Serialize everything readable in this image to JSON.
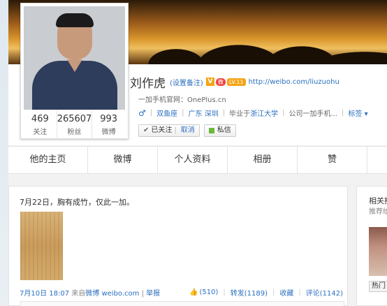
{
  "profile": {
    "name": "刘作虎",
    "remark_link": "(设置备注)",
    "badge_v": "V",
    "badge_club": "微",
    "badge_level": "LV.11",
    "home_url": "http://weibo.com/liuzuohu",
    "intro_label": "一加手机官网：",
    "intro_value": "OnePlus.cn",
    "gender_icon": "♂",
    "zodiac": "双鱼座",
    "location": "广东 深圳",
    "school_prefix": "毕业于",
    "school": "浙江大学",
    "company": "公司一加手机...",
    "tags_label": "标签"
  },
  "stats": [
    {
      "num": "469",
      "label": "关注"
    },
    {
      "num": "265607",
      "label": "粉丝"
    },
    {
      "num": "993",
      "label": "微博"
    }
  ],
  "buttons": {
    "followed": "已关注",
    "cancel": "取消",
    "message": "私信"
  },
  "tabs": [
    "他的主页",
    "微博",
    "个人资料",
    "相册",
    "赞"
  ],
  "post": {
    "text": "7月22日，胸有成竹，仅此一加。",
    "time": "7月10日 18:07",
    "source_prefix": "来自",
    "source_link": "微博 weibo.com",
    "report": "举报",
    "likes": "(510)",
    "repost": "转发(1189)",
    "collect": "收藏",
    "comment": "评论(1142)"
  },
  "sidebar": {
    "title": "相关推",
    "subtitle": "推荐给",
    "hot_button": "热门"
  },
  "colors": {
    "link": "#2a6fc0",
    "badge_orange": "#f4a417",
    "message_green": "#6ab93a"
  }
}
